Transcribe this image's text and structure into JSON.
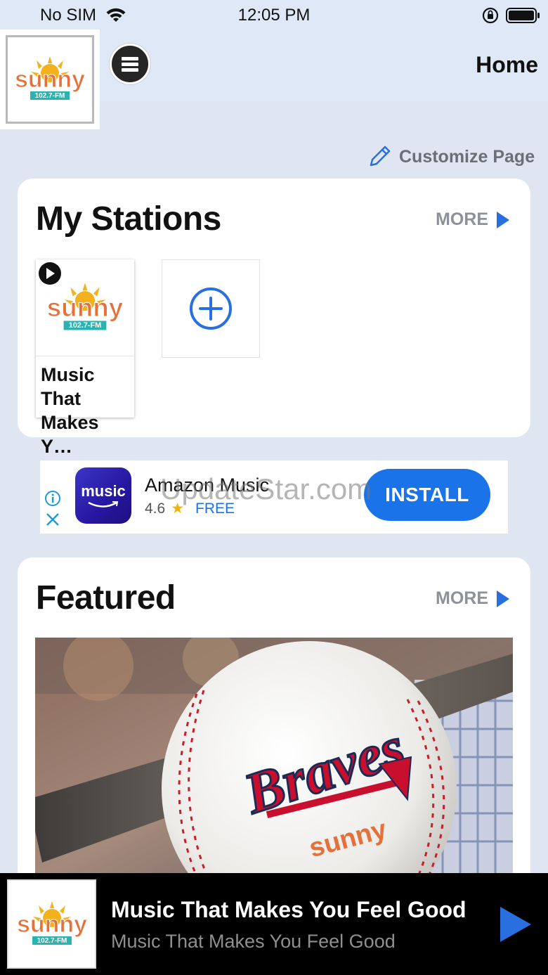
{
  "status_bar": {
    "carrier": "No SIM",
    "time": "12:05 PM"
  },
  "header": {
    "title": "Home",
    "logo_alt": "sunny 102.7-FM",
    "menu_icon": "hamburger-icon"
  },
  "customize": {
    "label": "Customize Page"
  },
  "my_stations": {
    "title": "My Stations",
    "more_label": "MORE",
    "stations": [
      {
        "name": "Music That Makes Y…"
      }
    ]
  },
  "ad": {
    "app_icon_text": "music",
    "app_name": "Amazon Music",
    "rating": "4.6",
    "price": "FREE",
    "install_label": "INSTALL"
  },
  "watermark": "UpdateStar.com",
  "featured": {
    "title": "Featured",
    "more_label": "MORE",
    "image_alt": "Braves on Sunny baseball"
  },
  "now_playing": {
    "title": "Music That Makes You Feel Good",
    "subtitle": "Music That Makes You Feel Good"
  },
  "colors": {
    "accent": "#1a73e8",
    "page_bg": "#dfe6f1",
    "player_bg": "#000000"
  }
}
